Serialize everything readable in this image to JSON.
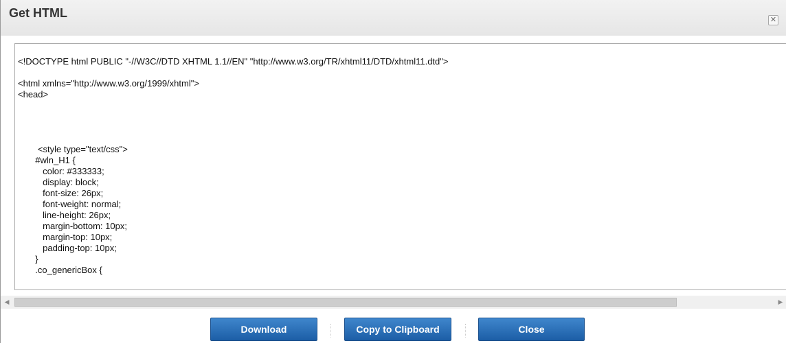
{
  "dialog": {
    "title": "Get HTML",
    "close_icon": "close-icon"
  },
  "code": {
    "lines": [
      "<!DOCTYPE html PUBLIC \"-//W3C//DTD XHTML 1.1//EN\" \"http://www.w3.org/TR/xhtml11/DTD/xhtml11.dtd\">",
      "",
      "<html xmlns=\"http://www.w3.org/1999/xhtml\">",
      "<head>",
      "",
      "",
      "",
      "",
      "        <style type=\"text/css\">",
      "       #wln_H1 {",
      "          color: #333333;",
      "          display: block;",
      "          font-size: 26px;",
      "          font-weight: normal;",
      "          line-height: 26px;",
      "          margin-bottom: 10px;",
      "          margin-top: 10px;",
      "          padding-top: 10px;",
      "       }",
      "       .co_genericBox {"
    ]
  },
  "footer": {
    "download_label": "Download",
    "copy_label": "Copy to Clipboard",
    "close_label": "Close"
  },
  "scrollbar": {
    "left_arrow": "scroll-left-arrow-icon",
    "right_arrow": "scroll-right-arrow-icon"
  }
}
